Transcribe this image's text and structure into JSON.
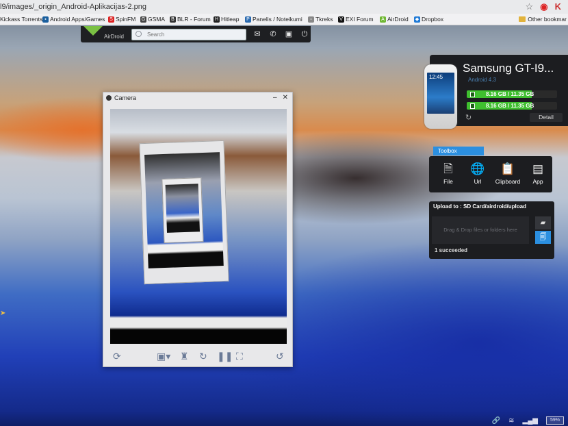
{
  "browser": {
    "url": "l9/images/_origin_Android-Aplikacijas-2.png",
    "bookmarks": [
      "Kickass Torrents",
      "Android Apps/Games",
      "SpinFM",
      "GSMA",
      "BLR - Forum",
      "Hitleap",
      "Panelis / Noteikumi",
      "Tkreks",
      "EXI Forum",
      "AirDroid",
      "Dropbox"
    ],
    "other_bookmarks": "Other bookmar"
  },
  "airdroid": {
    "logo": "AirDroid",
    "search_placeholder": "Search"
  },
  "device": {
    "name": "Samsung GT-I9...",
    "android": "Android 4.3",
    "clock": "12:45",
    "storage": [
      {
        "label": "8.16 GB / 11.35 GB",
        "fraction": 0.72
      },
      {
        "label": "8.16 GB / 11.35 GB",
        "fraction": 0.72
      }
    ],
    "detail": "Detail"
  },
  "toolbox": {
    "label": "Toolbox",
    "tools": [
      "File",
      "Url",
      "Clipboard",
      "App"
    ]
  },
  "upload": {
    "title": "Upload to : SD Card/airdroid/upload",
    "drop": "Drag & Drop files or folders here",
    "status": "1 succeeded"
  },
  "camera": {
    "title": "Camera"
  },
  "taskbar": {
    "battery": "59%"
  },
  "colors": {
    "accent": "#2b8fe0",
    "storage_green": "#3fbf2f",
    "panel": "#1c1d20"
  }
}
